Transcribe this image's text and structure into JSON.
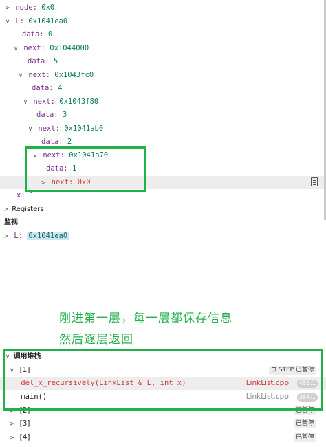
{
  "variables": {
    "node": {
      "key": "node:",
      "value": "0x0"
    },
    "L": {
      "key": "L:",
      "value": "0x1041ea0"
    },
    "d0": {
      "key": "data:",
      "value": "0"
    },
    "n1": {
      "key": "next:",
      "value": "0x1044000"
    },
    "d1": {
      "key": "data:",
      "value": "5"
    },
    "n2": {
      "key": "next:",
      "value": "0x1043fc0"
    },
    "d2": {
      "key": "data:",
      "value": "4"
    },
    "n3": {
      "key": "next:",
      "value": "0x1043f80"
    },
    "d3": {
      "key": "data:",
      "value": "3"
    },
    "n4": {
      "key": "next:",
      "value": "0x1041ab0"
    },
    "d4": {
      "key": "data:",
      "value": "2"
    },
    "n5": {
      "key": "next:",
      "value": "0x1041a70"
    },
    "d5": {
      "key": "data:",
      "value": "1"
    },
    "n6": {
      "key": "next:",
      "value": "0x0"
    },
    "x": {
      "key": "x:",
      "value": "1"
    }
  },
  "registers": {
    "label": "Registers"
  },
  "watch": {
    "title": "监视",
    "item_key": "L:",
    "item_value": "0x1041ea0"
  },
  "annotation": {
    "line1": "刚进第一层，每一层都保存信息",
    "line2": "然后逐层返回"
  },
  "callstack": {
    "title": "调用堆栈",
    "threads": [
      {
        "label": "[1]",
        "status": "已暂停",
        "step": "STEP"
      },
      {
        "label": "[2]",
        "status": "已暂停"
      },
      {
        "label": "[3]",
        "status": "已暂停"
      },
      {
        "label": "[4]",
        "status": "已暂停"
      }
    ],
    "frames": [
      {
        "name": "del_x_recursively(LinkList & L, int x)",
        "file": "LinkList.cpp",
        "line": "488:1"
      },
      {
        "name": "main()",
        "file": "LinkList.cpp",
        "line": "384:1"
      }
    ]
  },
  "colors": {
    "annotation": "#1fb24a",
    "key": "#7a2d8c",
    "value": "#097a5a",
    "active": "#d13b3b"
  }
}
